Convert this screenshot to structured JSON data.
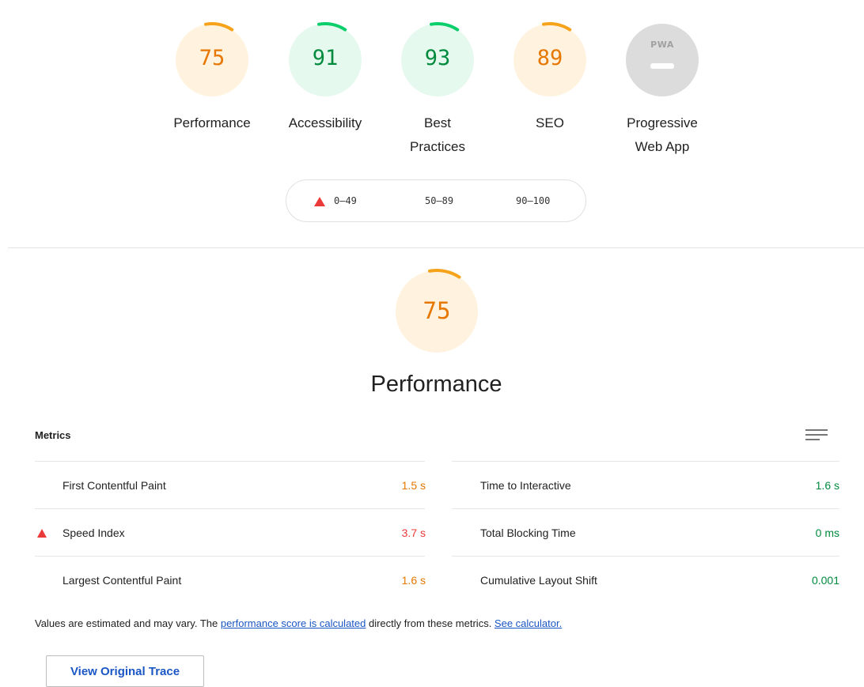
{
  "categories": [
    {
      "label": "Performance",
      "score": 75,
      "status": "average"
    },
    {
      "label": "Accessibility",
      "score": 91,
      "status": "pass"
    },
    {
      "label": "Best\nPractices",
      "score": 93,
      "status": "pass"
    },
    {
      "label": "SEO",
      "score": 89,
      "status": "average"
    },
    {
      "label": "Progressive\nWeb App",
      "badge": "PWA",
      "status": "na"
    }
  ],
  "legend": {
    "fail": "0–49",
    "average": "50–89",
    "pass": "90–100"
  },
  "performance": {
    "score": 75,
    "title": "Performance"
  },
  "metrics": {
    "header": "Metrics",
    "left": [
      {
        "name": "First Contentful Paint",
        "value": "1.5 s",
        "status": "average"
      },
      {
        "name": "Speed Index",
        "value": "3.7 s",
        "status": "fail"
      },
      {
        "name": "Largest Contentful Paint",
        "value": "1.6 s",
        "status": "average"
      }
    ],
    "right": [
      {
        "name": "Time to Interactive",
        "value": "1.6 s",
        "status": "pass"
      },
      {
        "name": "Total Blocking Time",
        "value": "0 ms",
        "status": "pass"
      },
      {
        "name": "Cumulative Layout Shift",
        "value": "0.001",
        "status": "pass"
      }
    ]
  },
  "footnote": {
    "before": "Values are estimated and may vary. The ",
    "link1": "performance score is calculated",
    "middle": " directly from these metrics. ",
    "link2": "See calculator."
  },
  "trace_button": "View Original Trace",
  "colors": {
    "average": "#e67700",
    "average_bg": "#fff3e0",
    "pass": "#0cce6b",
    "pass_text": "#008a3e",
    "pass_bg": "#e6f9ee",
    "fail": "#eb3a3a",
    "na": "#dcdcdc",
    "link": "#1a56c4"
  }
}
